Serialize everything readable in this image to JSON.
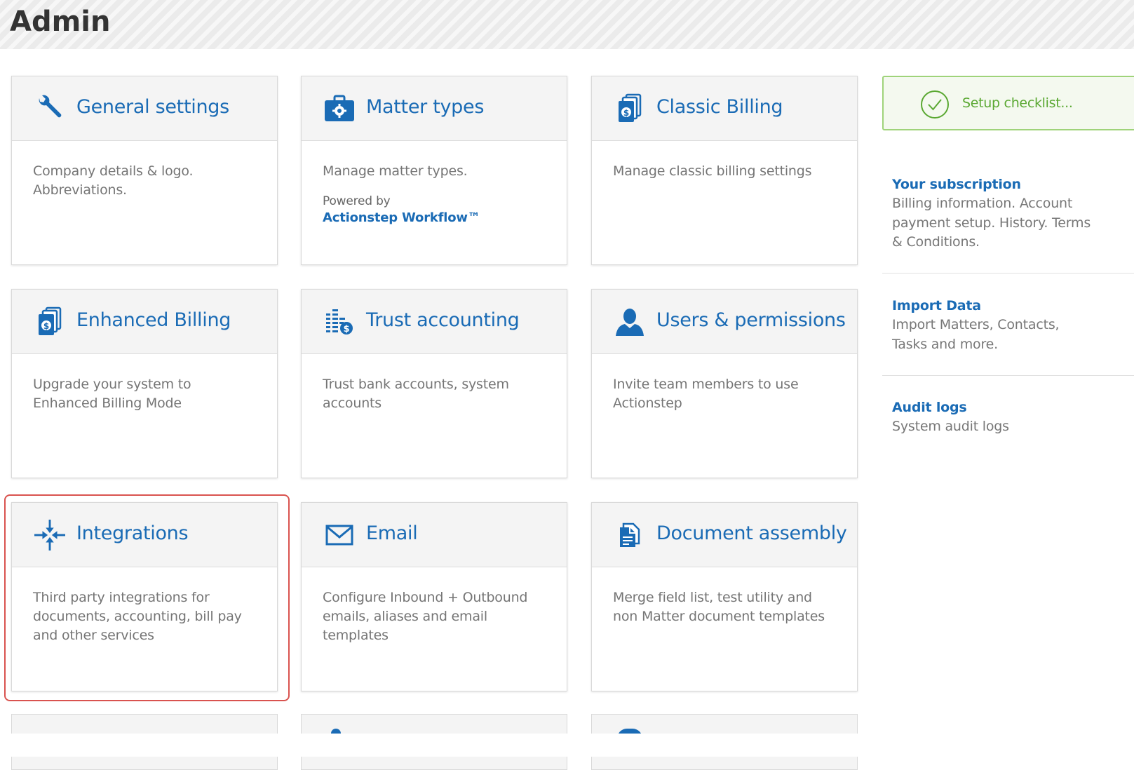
{
  "page": {
    "title": "Admin"
  },
  "cards": [
    {
      "id": "general-settings",
      "title": "General settings",
      "icon": "wrench-icon",
      "lines": [
        "Company details & logo.",
        "Abbreviations."
      ]
    },
    {
      "id": "matter-types",
      "title": "Matter types",
      "icon": "briefcase-gear-icon",
      "lines": [
        "Manage matter types."
      ],
      "powered_by": "Powered by",
      "workflow_link": "Actionstep Workflow™"
    },
    {
      "id": "classic-billing",
      "title": "Classic Billing",
      "icon": "invoice-dollar-icon",
      "lines": [
        "Manage classic billing settings"
      ]
    },
    {
      "id": "enhanced-billing",
      "title": "Enhanced Billing",
      "icon": "invoice-dollar-icon",
      "lines": [
        "Upgrade your system to",
        "Enhanced Billing Mode"
      ]
    },
    {
      "id": "trust-accounting",
      "title": "Trust accounting",
      "icon": "coins-dollar-icon",
      "lines": [
        "Trust bank accounts, system",
        "accounts"
      ]
    },
    {
      "id": "users-permissions",
      "title": "Users & permissions",
      "icon": "user-icon",
      "lines": [
        "Invite team members to use",
        "Actionstep"
      ]
    },
    {
      "id": "integrations",
      "title": "Integrations",
      "icon": "integrations-arrows-icon",
      "lines": [
        "Third party integrations for",
        "documents, accounting, bill pay",
        "and other services"
      ]
    },
    {
      "id": "email",
      "title": "Email",
      "icon": "envelope-icon",
      "lines": [
        "Configure Inbound + Outbound",
        "emails, aliases and email",
        "templates"
      ]
    },
    {
      "id": "document-assembly",
      "title": "Document assembly",
      "icon": "document-icon",
      "lines": [
        "Merge field list, test utility and",
        "non Matter document templates"
      ]
    }
  ],
  "sidebar": {
    "setup_checklist": {
      "label": "Setup checklist...",
      "icon": "check-circle-icon",
      "color": "#5aa832"
    },
    "items": [
      {
        "title": "Your subscription",
        "lines": [
          "Billing information. Account",
          "payment setup. History. Terms",
          "& Conditions."
        ]
      },
      {
        "title": "Import Data",
        "lines": [
          "Import Matters, Contacts,",
          "Tasks and more."
        ]
      },
      {
        "title": "Audit logs",
        "lines": [
          "System audit logs"
        ]
      }
    ]
  },
  "colors": {
    "accent": "#1a6bb5",
    "highlight": "#d9534f",
    "setup_border": "#9fd37a"
  }
}
